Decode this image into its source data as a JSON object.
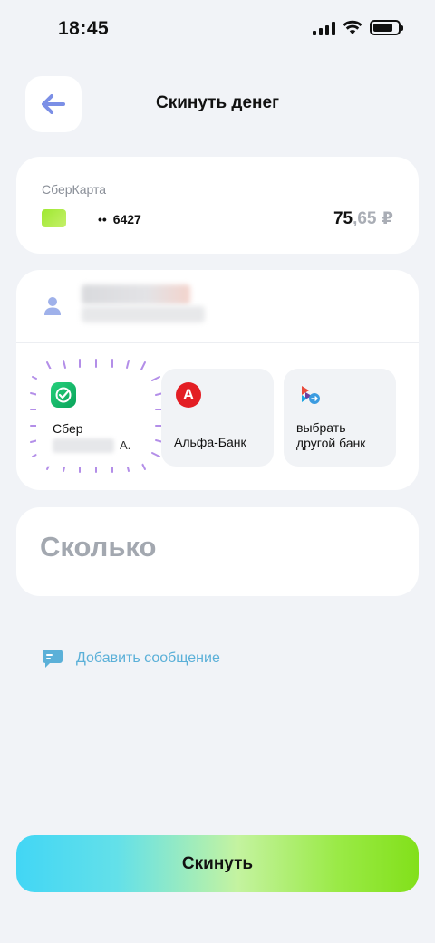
{
  "status_bar": {
    "time": "18:45",
    "battery_level": 0.8
  },
  "header": {
    "title": "Скинуть денег",
    "back_icon": "arrow-left-icon"
  },
  "account": {
    "label": "СберКарта",
    "card_dots": "••",
    "card_last4": "6427",
    "balance_int": "75",
    "balance_frac": ",65 ₽",
    "card_color": "#9ee831"
  },
  "recipient": {
    "icon": "person-icon",
    "banks": [
      {
        "name": "Сбер",
        "suffix": "А.",
        "icon": "sber-logo-icon",
        "selected": true,
        "color": "#21c06e"
      },
      {
        "name": "Альфа-Банк",
        "logo_letter": "А",
        "icon": "alfa-logo-icon",
        "color": "#e31e24"
      },
      {
        "name_line1": "выбрать",
        "name_line2": "другой банк",
        "icon": "sbp-logo-icon"
      }
    ]
  },
  "amount": {
    "placeholder": "Сколько"
  },
  "message": {
    "label": "Добавить сообщение",
    "icon": "chat-icon",
    "color": "#5bb0d8"
  },
  "submit": {
    "label": "Скинуть"
  }
}
